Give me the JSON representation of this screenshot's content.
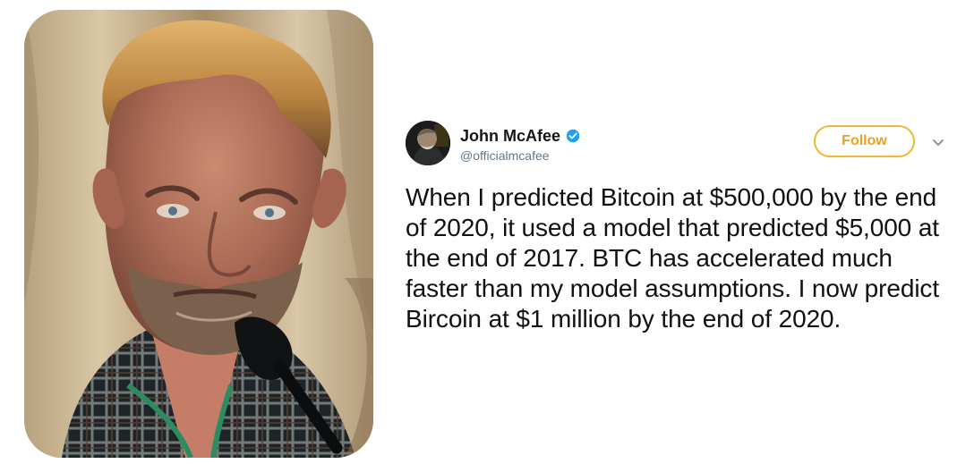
{
  "tweet": {
    "display_name": "John McAfee",
    "handle": "@officialmcafee",
    "follow_label": "Follow",
    "text": "When I predicted Bitcoin at $500,000 by the end of 2020, it used a model that predicted $5,000 at the end of 2017. BTC has accelerated much faster than my model assumptions. I now predict Bircoin at $1 million by the end of 2020.",
    "verified_icon": "verified-badge-icon",
    "menu_icon": "chevron-down-icon"
  },
  "colors": {
    "follow_accent": "#f2b535",
    "verified_blue": "#1da1f2",
    "handle_gray": "#657786"
  }
}
